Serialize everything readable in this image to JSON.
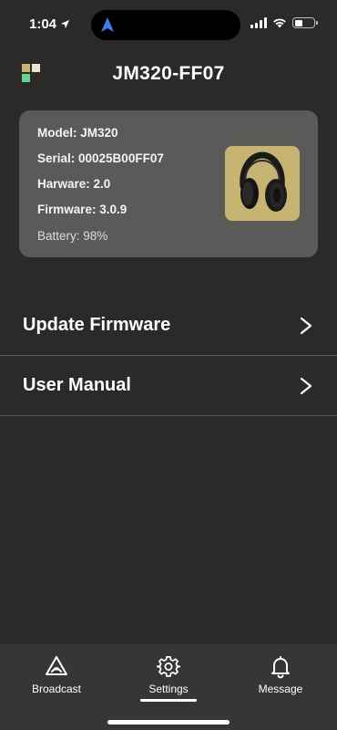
{
  "status_bar": {
    "time": "1:04"
  },
  "header": {
    "title": "JM320-FF07",
    "logo_colors": [
      "#c7b470",
      "#eae3d1",
      "#5fd596"
    ]
  },
  "device_card": {
    "model": "Model: JM320",
    "serial": "Serial: 00025B00FF07",
    "hardware": "Harware: 2.0",
    "firmware": "Firmware: 3.0.9",
    "battery": "Battery: 98%",
    "thumb_bg": "#c7b470",
    "image_icon": "headphones-image"
  },
  "menu": {
    "items": [
      {
        "label": "Update Firmware",
        "icon": "chevron-right-icon"
      },
      {
        "label": "User Manual",
        "icon": "chevron-right-icon"
      }
    ]
  },
  "tab_bar": {
    "tabs": [
      {
        "label": "Broadcast",
        "icon": "broadcast-icon"
      },
      {
        "label": "Settings",
        "icon": "gear-icon",
        "active": true
      },
      {
        "label": "Message",
        "icon": "bell-icon"
      }
    ]
  },
  "colors": {
    "background": "#2b2a29",
    "card": "#5a5a59",
    "accent_gold": "#c7b470",
    "tab_bar": "#373636"
  }
}
